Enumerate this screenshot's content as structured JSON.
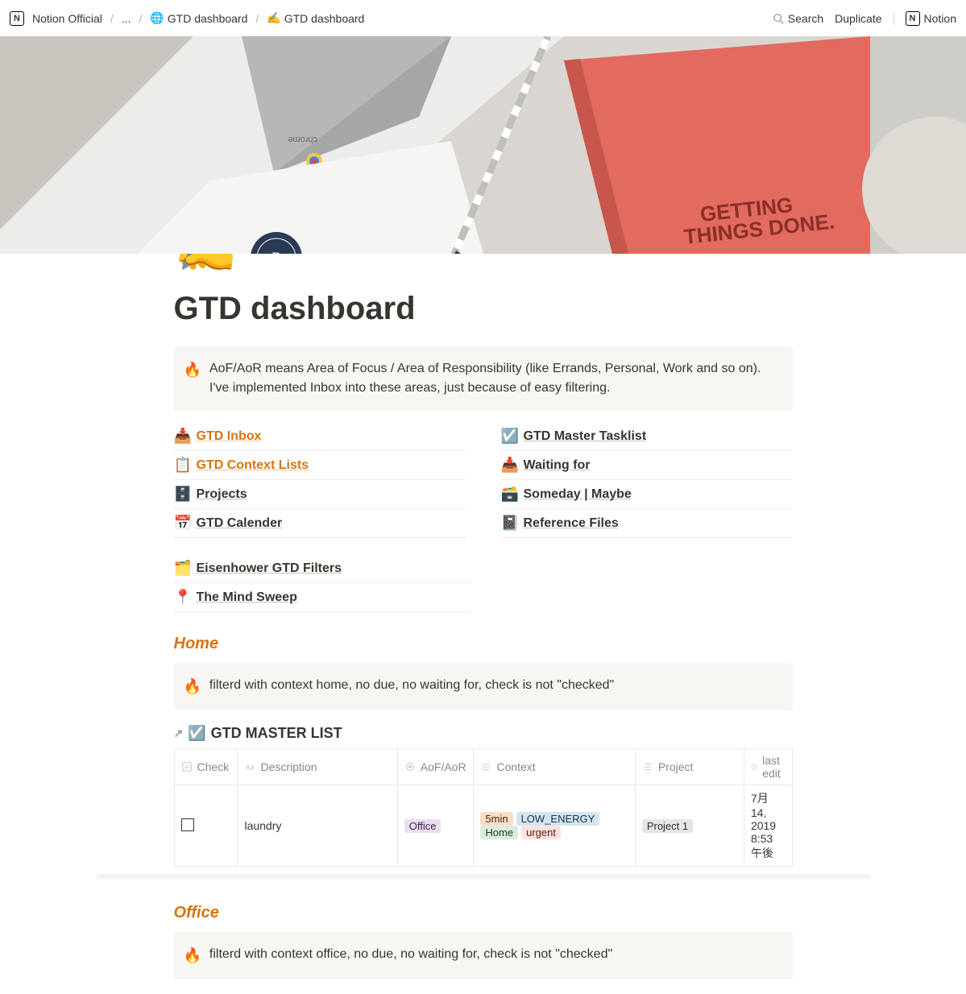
{
  "breadcrumb": {
    "workspace": "Notion Official",
    "ellipsis": "...",
    "parent_icon": "🌐",
    "parent": "GTD dashboard",
    "current_icon": "✍️",
    "current": "GTD dashboard"
  },
  "top_actions": {
    "search": "Search",
    "duplicate": "Duplicate",
    "notion": "Notion"
  },
  "page": {
    "icon": "✍️",
    "title": "GTD dashboard"
  },
  "intro_callout": {
    "icon": "🔥",
    "text": "AoF/AoR means Area of Focus / Area of Responsibility (like Errands, Personal, Work and so on). I've implemented Inbox into these areas, just because of easy filtering."
  },
  "links_left": [
    {
      "icon": "📥",
      "label": "GTD Inbox",
      "orange": true
    },
    {
      "icon": "📋",
      "label": "GTD Context Lists",
      "orange": true
    },
    {
      "icon": "🗄️",
      "label": "Projects",
      "orange": false
    },
    {
      "icon": "📅",
      "label": "GTD Calender",
      "orange": false
    }
  ],
  "links_right": [
    {
      "icon": "☑️",
      "label": "GTD Master Tasklist",
      "orange": false
    },
    {
      "icon": "📥",
      "label": "Waiting for",
      "orange": false
    },
    {
      "icon": "🗃️",
      "label": "Someday | Maybe",
      "orange": false
    },
    {
      "icon": "📓",
      "label": "Reference Files",
      "orange": false
    }
  ],
  "extra_links": [
    {
      "icon": "🗂️",
      "label": "Eisenhower GTD Filters",
      "orange": false
    },
    {
      "icon": "📍",
      "label": "The Mind Sweep",
      "orange": false
    }
  ],
  "home": {
    "heading": "Home",
    "callout_icon": "🔥",
    "callout_text": "filterd with context home, no due, no waiting for, check is not \"checked\"",
    "db_icon": "☑️",
    "db_title": "GTD MASTER LIST",
    "columns": {
      "check": "Check",
      "description": "Description",
      "aof": "AoF/AoR",
      "context": "Context",
      "project": "Project",
      "last_edit": "last edit"
    },
    "row": {
      "description": "laundry",
      "aof": "Office",
      "context": [
        "5min",
        "LOW_ENERGY",
        "Home",
        "urgent"
      ],
      "project": "Project 1",
      "last_edit": "7月 14, 2019 8:53 午後"
    }
  },
  "office": {
    "heading": "Office",
    "callout_icon": "🔥",
    "callout_text": "filterd with context office, no due, no waiting for, check is not \"checked\""
  }
}
